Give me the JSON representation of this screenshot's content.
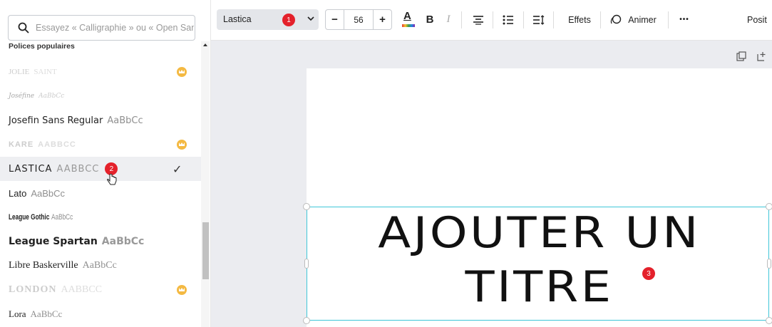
{
  "search": {
    "placeholder": "Essayez « Calligraphie » ou « Open San"
  },
  "panel": {
    "section_title": "Polices populaires",
    "fonts": [
      {
        "name": "JOLIE",
        "sample": "SAINT",
        "faded": true,
        "premium": true
      },
      {
        "name": "Joséfine",
        "sample": "AaBbCc",
        "faded": true,
        "premium": false
      },
      {
        "name": "Josefin Sans Regular",
        "sample": "AaBbCc",
        "faded": false,
        "premium": false
      },
      {
        "name": "KARE",
        "sample": "AABBCC",
        "faded": true,
        "premium": true
      },
      {
        "name": "LASTICA",
        "sample": "AABBCC",
        "faded": false,
        "premium": false,
        "selected": true
      },
      {
        "name": "Lato",
        "sample": "AaBbCc",
        "faded": false,
        "premium": false
      },
      {
        "name": "League Gothic",
        "sample": "AaBbCc",
        "faded": false,
        "premium": false
      },
      {
        "name": "League Spartan",
        "sample": "AaBbCc",
        "faded": false,
        "premium": false
      },
      {
        "name": "Libre Baskerville",
        "sample": "AaBbCc",
        "faded": false,
        "premium": false
      },
      {
        "name": "LONDON",
        "sample": "AABBCC",
        "faded": true,
        "premium": true
      },
      {
        "name": "Lora",
        "sample": "AaBbCc",
        "faded": false,
        "premium": false
      }
    ],
    "badge_selected": "2",
    "check": "✓"
  },
  "toolbar": {
    "font_name": "Lastica",
    "font_badge": "1",
    "font_size": "56",
    "minus": "−",
    "plus": "+",
    "bold": "B",
    "italic": "I",
    "effects": "Effets",
    "animate": "Animer",
    "more": "•••",
    "position": "Posit"
  },
  "canvas": {
    "title_line1": "AJOUTER UN",
    "title_line2": "TITRE",
    "title_badge": "3"
  },
  "colors": {
    "selection": "#3ec6d8",
    "badge": "#e4212b",
    "premium": "#f4b942"
  }
}
